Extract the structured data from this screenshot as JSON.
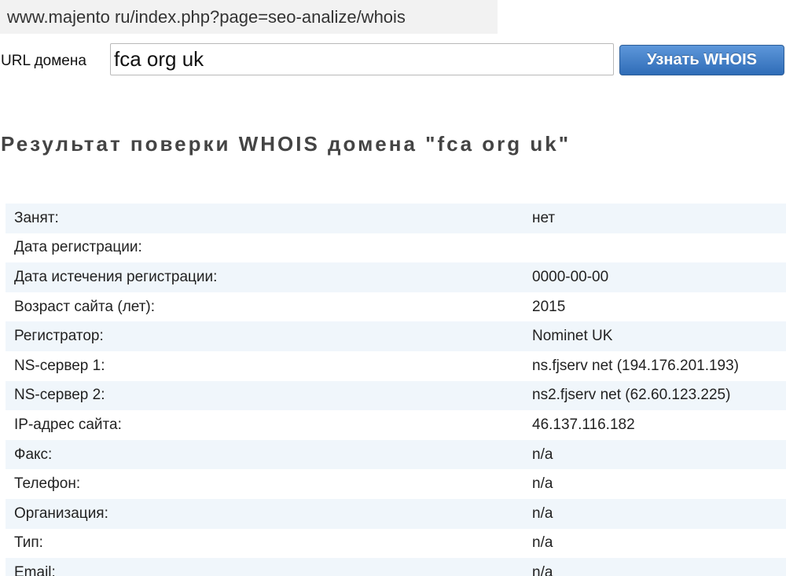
{
  "browser": {
    "url": "www.majento ru/index.php?page=seo-analize/whois"
  },
  "form": {
    "label": "URL домена",
    "input_value": "fca org uk",
    "submit_label": "Узнать WHOIS"
  },
  "result": {
    "title": "Результат поверки WHOIS домена \"fca org uk\"",
    "rows": [
      {
        "key": "Занят:",
        "value": "нет"
      },
      {
        "key": "Дата регистрации:",
        "value": ""
      },
      {
        "key": "Дата истечения регистрации:",
        "value": "0000-00-00"
      },
      {
        "key": "Возраст сайта (лет):",
        "value": "2015"
      },
      {
        "key": "Регистратор:",
        "value": "Nominet UK"
      },
      {
        "key": "NS-сервер 1:",
        "value": "ns.fjserv net (194.176.201.193)"
      },
      {
        "key": "NS-сервер 2:",
        "value": "ns2.fjserv net (62.60.123.225)"
      },
      {
        "key": "IP-адрес сайта:",
        "value": "46.137.116.182"
      },
      {
        "key": "Факс:",
        "value": "n/a"
      },
      {
        "key": "Телефон:",
        "value": "n/a"
      },
      {
        "key": "Организация:",
        "value": "n/a"
      },
      {
        "key": "Тип:",
        "value": "n/a"
      },
      {
        "key": "Email:",
        "value": "n/a"
      }
    ]
  },
  "colors": {
    "row_stripe": "#f0f6fb",
    "button_top": "#5d97da",
    "button_bottom": "#2f6cb7",
    "address_bar_bg": "#f2f2f2"
  }
}
